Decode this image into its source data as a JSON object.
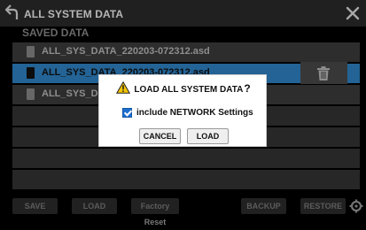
{
  "header": {
    "title": "ALL SYSTEM DATA"
  },
  "section": {
    "label": "SAVED DATA"
  },
  "files": [
    {
      "name": "ALL_SYS_DATA_220203-072312.asd",
      "selected": false
    },
    {
      "name": "ALL_SYS_DATA_220203-072312.asd",
      "selected": true
    },
    {
      "name": "ALL_SYS_DA",
      "selected": false
    }
  ],
  "footer": {
    "buttons": [
      "SAVE",
      "LOAD",
      "Factory Reset",
      "BACKUP",
      "RESTORE"
    ]
  },
  "dialog": {
    "title": "LOAD ALL SYSTEM DATA",
    "title_suffix": "?",
    "checkbox_label": "include NETWORK Settings",
    "checkbox_checked": true,
    "cancel_label": "CANCEL",
    "confirm_label": "LOAD"
  },
  "icons": {
    "back": "back-arrow-icon",
    "close": "close-icon",
    "warning": "warning-icon",
    "trash": "trash-icon",
    "file": "file-icon",
    "settings": "gear-icon"
  },
  "colors": {
    "selection": "#2f84c7",
    "checkbox": "#1e6fd0",
    "warning": "#f5c400"
  }
}
